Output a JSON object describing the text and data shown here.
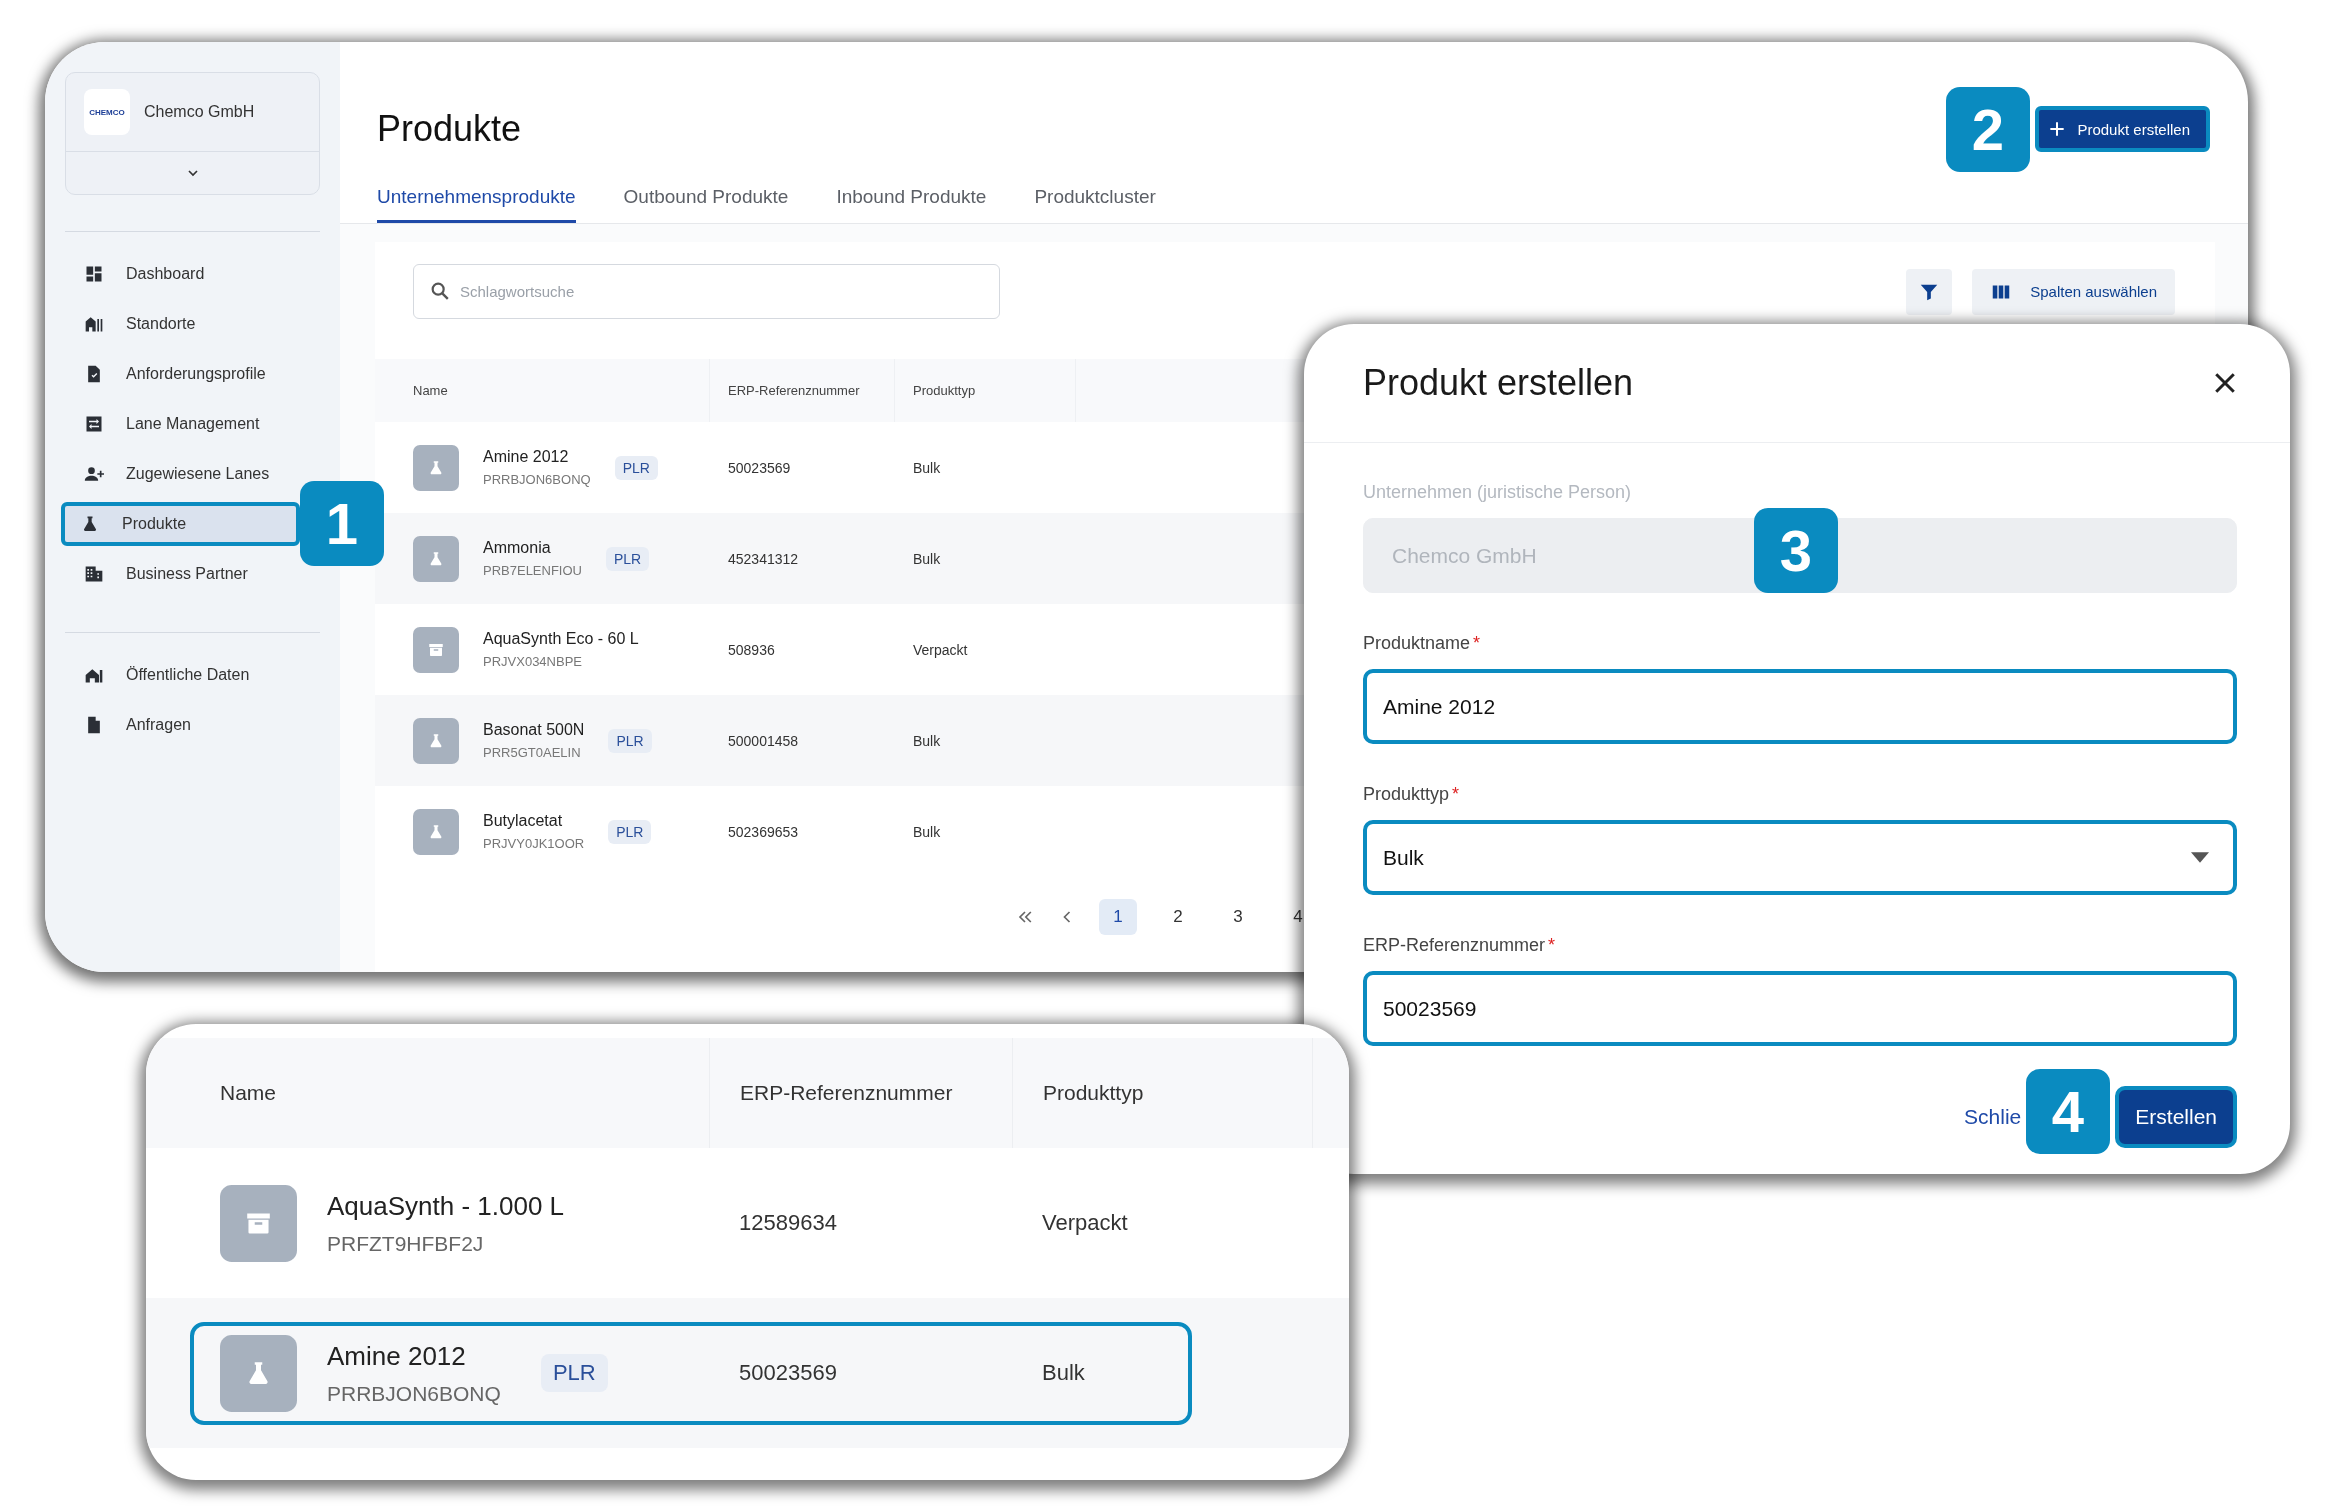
{
  "sidebar": {
    "company": {
      "logo": "CHEMCO",
      "name": "Chemco GmbH"
    },
    "groups": [
      {
        "items": [
          {
            "label": "Dashboard",
            "selected": false
          },
          {
            "label": "Standorte",
            "selected": false
          },
          {
            "label": "Anforderungsprofile",
            "selected": false
          },
          {
            "label": "Lane Management",
            "selected": false
          },
          {
            "label": "Zugewiesene Lanes",
            "selected": false
          },
          {
            "label": "Produkte",
            "selected": true
          },
          {
            "label": "Business Partner",
            "selected": false
          }
        ]
      },
      {
        "items": [
          {
            "label": "Öffentliche Daten",
            "selected": false
          },
          {
            "label": "Anfragen",
            "selected": false
          }
        ]
      }
    ]
  },
  "main": {
    "title": "Produkte",
    "create_button": "Produkt erstellen",
    "tabs": [
      {
        "label": "Unternehmensprodukte",
        "selected": true
      },
      {
        "label": "Outbound Produkte",
        "selected": false
      },
      {
        "label": "Inbound Produkte",
        "selected": false
      },
      {
        "label": "Produktcluster",
        "selected": false
      }
    ],
    "search": {
      "placeholder": "Schlagwortsuche"
    },
    "columns_button": "Spalten auswählen",
    "table": {
      "columns": [
        "Name",
        "ERP-Referenznummer",
        "Produkttyp"
      ],
      "rows": [
        {
          "kind": "bulk",
          "name": "Amine 2012",
          "code": "PRRBJON6BONQ",
          "tag": "PLR",
          "erp": "50023569",
          "type": "Bulk"
        },
        {
          "kind": "bulk",
          "name": "Ammonia",
          "code": "PRB7ELENFIOU",
          "tag": "PLR",
          "erp": "452341312",
          "type": "Bulk"
        },
        {
          "kind": "packed",
          "name": "AquaSynth Eco - 60 L",
          "code": "PRJVX034NBPE",
          "erp": "508936",
          "type": "Verpackt"
        },
        {
          "kind": "bulk",
          "name": "Basonat 500N",
          "code": "PRR5GT0AELIN",
          "tag": "PLR",
          "erp": "500001458",
          "type": "Bulk"
        },
        {
          "kind": "bulk",
          "name": "Butylacetat",
          "code": "PRJVY0JK1OOR",
          "tag": "PLR",
          "erp": "502369653",
          "type": "Bulk"
        }
      ]
    },
    "pagination": {
      "pages": [
        {
          "label": "1",
          "selected": true
        },
        {
          "label": "2",
          "selected": false
        },
        {
          "label": "3",
          "selected": false
        },
        {
          "label": "4",
          "selected": false
        }
      ]
    }
  },
  "dialog": {
    "title": "Produkt erstellen",
    "fields": [
      {
        "kind": "text",
        "label": "Unternehmen (juristische Person)",
        "value": "Chemco GmbH",
        "disabled": true,
        "highlighted": false
      },
      {
        "kind": "text",
        "label": "Produktname",
        "required_mark": "*",
        "value": "Amine 2012",
        "disabled": false,
        "highlighted": true
      },
      {
        "kind": "select",
        "label": "Produkttyp",
        "required_mark": "*",
        "value": "Bulk",
        "disabled": false,
        "highlighted": true
      },
      {
        "kind": "text",
        "label": "ERP-Referenznummer",
        "required_mark": "*",
        "value": "50023569",
        "disabled": false,
        "highlighted": true
      }
    ],
    "cancel_link": "Schlie",
    "submit_button": "Erstellen"
  },
  "zoom_panel": {
    "columns": [
      "Name",
      "ERP-Referenznummer",
      "Produkttyp"
    ],
    "rows": [
      {
        "kind": "packed",
        "name": "AquaSynth - 1.000 L",
        "code": "PRFZT9HFBF2J",
        "erp": "12589634",
        "type": "Verpackt",
        "highlighted": false
      },
      {
        "kind": "bulk",
        "name": "Amine 2012",
        "code": "PRRBJON6BONQ",
        "tag": "PLR",
        "erp": "50023569",
        "type": "Bulk",
        "highlighted": true
      }
    ]
  },
  "callouts": [
    {
      "number": "1"
    },
    {
      "number": "2"
    },
    {
      "number": "3"
    },
    {
      "number": "4"
    }
  ]
}
